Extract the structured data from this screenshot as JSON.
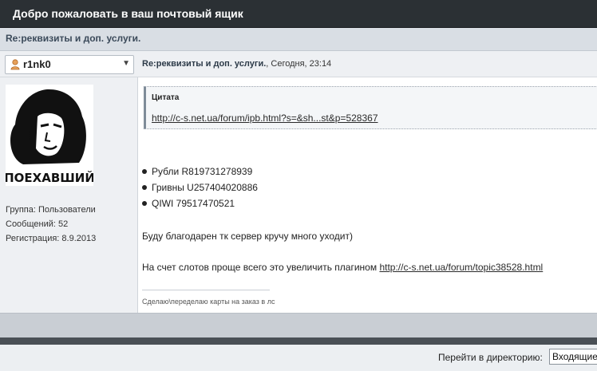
{
  "header": {
    "title": "Добро пожаловать в ваш почтовый ящик"
  },
  "topic": {
    "title": "Re:реквизиты и доп. услуги."
  },
  "post": {
    "author": "r1nk0",
    "title": "Re:реквизиты и доп. услуги.",
    "timestamp": ", Сегодня, 23:14"
  },
  "author_info": {
    "group": "Группа: Пользователи",
    "posts": "Сообщений: 52",
    "registered": "Регистрация: 8.9.2013",
    "avatar_caption": "ПОЕХАВШИЙ"
  },
  "quote": {
    "label": "Цитата",
    "link": "http://c-s.net.ua/forum/ipb.html?s=&sh...st&p=528367"
  },
  "body": {
    "bullets": [
      "Рубли R819731278939",
      "Гривны U257404020886",
      "QIWI 79517470521"
    ],
    "line1": "Буду благодарен тк сервер кручу много уходит)",
    "line2_text": "На счет слотов проще всего это увеличить плагином ",
    "line2_link": "http://c-s.net.ua/forum/topic38528.html",
    "signature": "Сделаю\\переделаю карты на заказ в лс"
  },
  "jump": {
    "label": "Перейти в директорию:",
    "selected": "Входящие"
  },
  "icons": {
    "user": "user-icon",
    "dropdown": "chevron-down-icon"
  }
}
